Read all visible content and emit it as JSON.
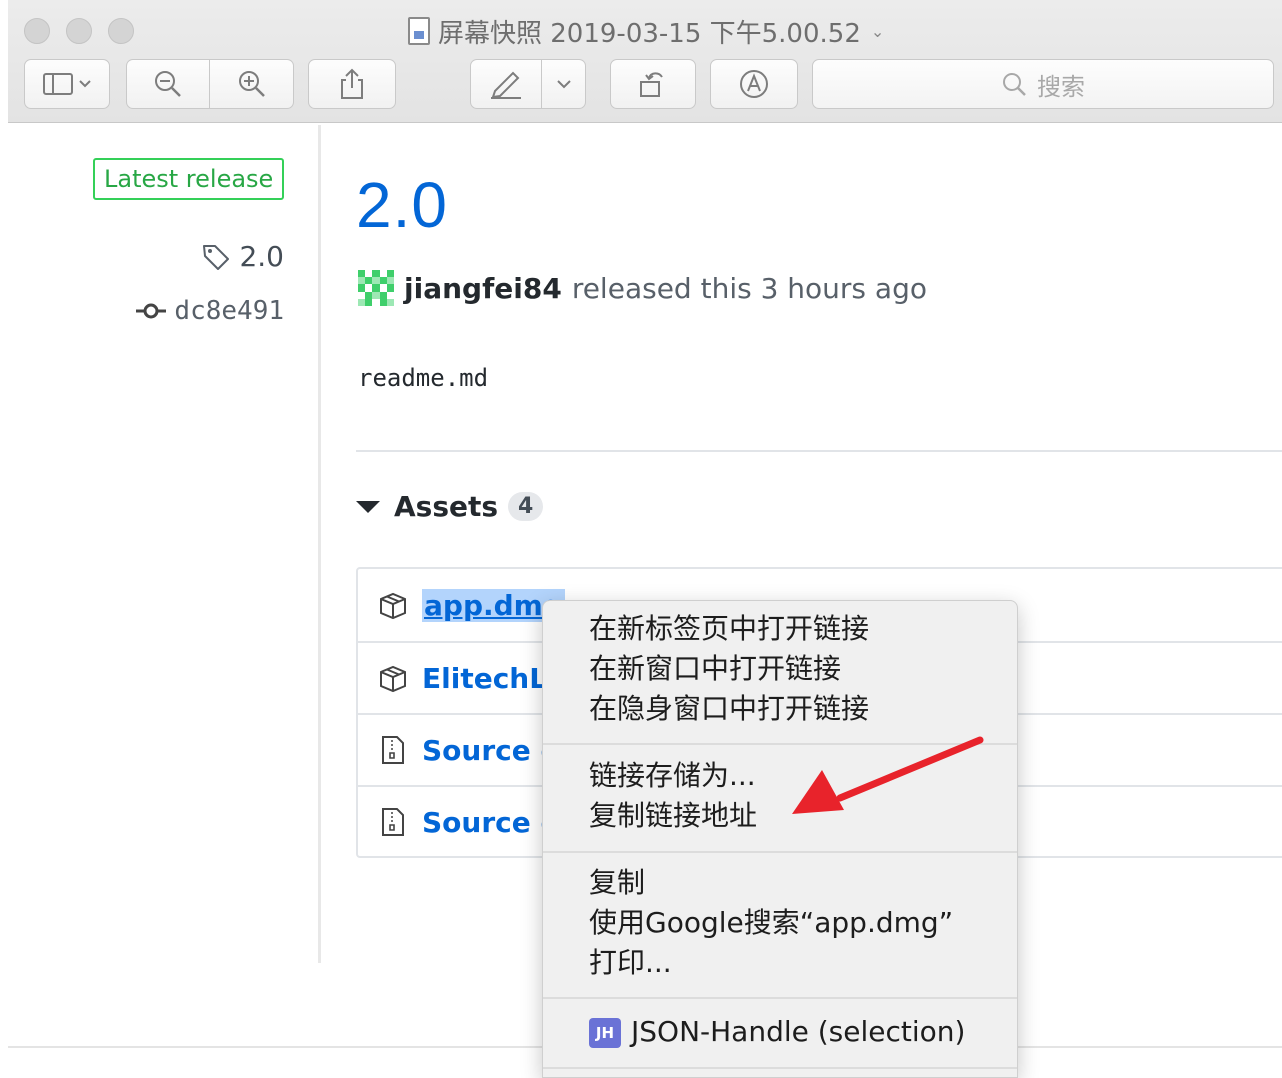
{
  "window": {
    "title": "屏幕快照 2019-03-15 下午5.00.52",
    "title_chevron": "⌄",
    "search_placeholder": "搜索"
  },
  "toolbar": {
    "icons": [
      "sidebar-icon",
      "zoom-out-icon",
      "zoom-in-icon",
      "share-icon",
      "markup-pen-icon",
      "rotate-icon",
      "annotate-icon",
      "search-icon"
    ]
  },
  "release": {
    "badge": "Latest release",
    "tag": "2.0",
    "commit": "dc8e491",
    "title": "2.0",
    "author": "jiangfei84",
    "meta_text": "released this 3 hours ago",
    "readme": "readme.md"
  },
  "assets": {
    "label": "Assets",
    "count": "4",
    "items": [
      {
        "name": "app.dmg",
        "kind": "package"
      },
      {
        "name": "ElitechL",
        "kind": "package"
      },
      {
        "name": "Source c",
        "kind": "zip"
      },
      {
        "name": "Source c",
        "kind": "zip"
      }
    ]
  },
  "context_menu": {
    "group1": [
      "在新标签页中打开链接",
      "在新窗口中打开链接",
      "在隐身窗口中打开链接"
    ],
    "group2": [
      "链接存储为...",
      "复制链接地址"
    ],
    "group3": [
      "复制",
      "使用Google搜索“app.dmg”",
      "打印..."
    ],
    "extension": {
      "icon_text": "JH",
      "label": "JSON-Handle (selection)"
    }
  },
  "colors": {
    "link": "#0366d6",
    "badge_green": "#28a745",
    "arrow_red": "#e8232b",
    "selection": "#b3d4fc"
  }
}
